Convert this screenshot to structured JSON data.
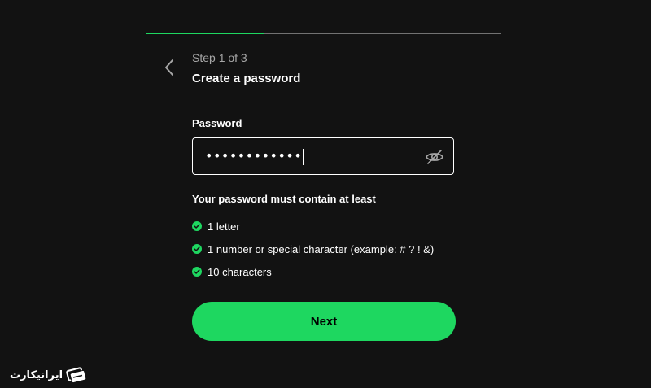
{
  "progress": {
    "value": 0.33,
    "color": "#1ed760",
    "track_color": "#727272"
  },
  "header": {
    "back_icon": "chevron-left-icon",
    "step": "Step 1 of 3",
    "title": "Create a password"
  },
  "form": {
    "password_label": "Password",
    "password_value": "••••••••••••",
    "visibility_icon": "eye-off-icon"
  },
  "requirements": {
    "heading": "Your password must contain at least",
    "items": [
      {
        "label": "1 letter",
        "met": true
      },
      {
        "label": "1 number or special character (example: # ? ! &)",
        "met": true
      },
      {
        "label": "10 characters",
        "met": true
      }
    ],
    "check_color": "#1ed760"
  },
  "next_button": {
    "label": "Next"
  },
  "watermark": {
    "text": "ایرانیکارت"
  }
}
